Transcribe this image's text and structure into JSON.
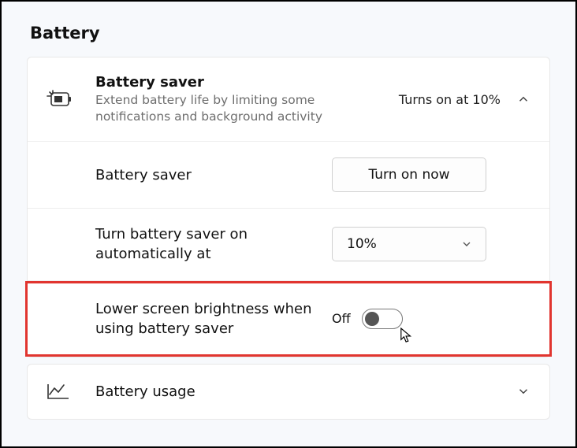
{
  "section": {
    "title": "Battery"
  },
  "saver": {
    "title": "Battery saver",
    "description": "Extend battery life by limiting some notifications and background activity",
    "status": "Turns on at 10%"
  },
  "rows": {
    "toggle_now": {
      "label": "Battery saver",
      "button": "Turn on now"
    },
    "auto_at": {
      "label": "Turn battery saver on automatically at",
      "value": "10%"
    },
    "brightness": {
      "label": "Lower screen brightness when using battery saver",
      "state": "Off"
    }
  },
  "usage": {
    "label": "Battery usage"
  }
}
